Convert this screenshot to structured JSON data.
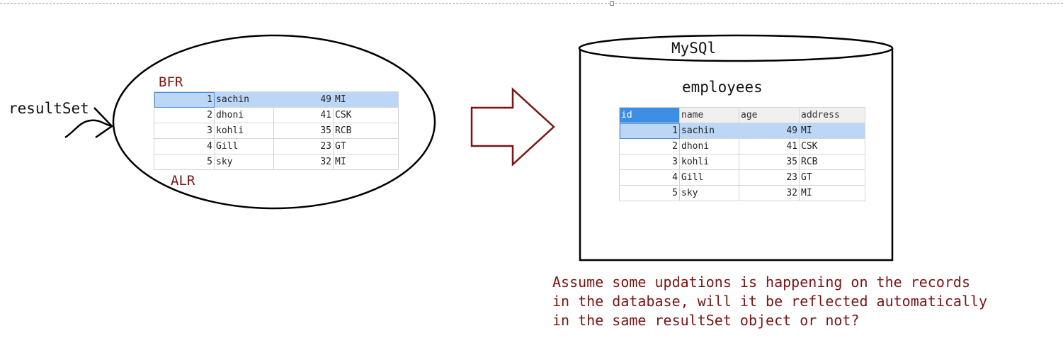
{
  "labels": {
    "result_set": "resultSet",
    "bfr": "BFR",
    "alr": "ALR",
    "database": "MySQl",
    "table_name": "employees"
  },
  "question": [
    "Assume some updations is happening on the records",
    "in the database, will it be reflected automatically",
    "in the same resultSet object or not?"
  ],
  "result_set_rows": [
    {
      "id": "1",
      "name": "sachin",
      "age": "49",
      "address": "MI"
    },
    {
      "id": "2",
      "name": "dhoni",
      "age": "41",
      "address": "CSK"
    },
    {
      "id": "3",
      "name": "kohli",
      "age": "35",
      "address": "RCB"
    },
    {
      "id": "4",
      "name": "Gill",
      "age": "23",
      "address": "GT"
    },
    {
      "id": "5",
      "name": "sky",
      "age": "32",
      "address": "MI"
    }
  ],
  "employees_table": {
    "columns": [
      "id",
      "name",
      "age",
      "address"
    ],
    "rows": [
      {
        "id": "1",
        "name": "sachin",
        "age": "49",
        "address": "MI"
      },
      {
        "id": "2",
        "name": "dhoni",
        "age": "41",
        "address": "CSK"
      },
      {
        "id": "3",
        "name": "kohli",
        "age": "35",
        "address": "RCB"
      },
      {
        "id": "4",
        "name": "Gill",
        "age": "23",
        "address": "GT"
      },
      {
        "id": "5",
        "name": "sky",
        "age": "32",
        "address": "MI"
      }
    ]
  },
  "colors": {
    "annotation": "#7a1414",
    "selection": "#bcd6f5",
    "header_active": "#3d8fe6"
  }
}
